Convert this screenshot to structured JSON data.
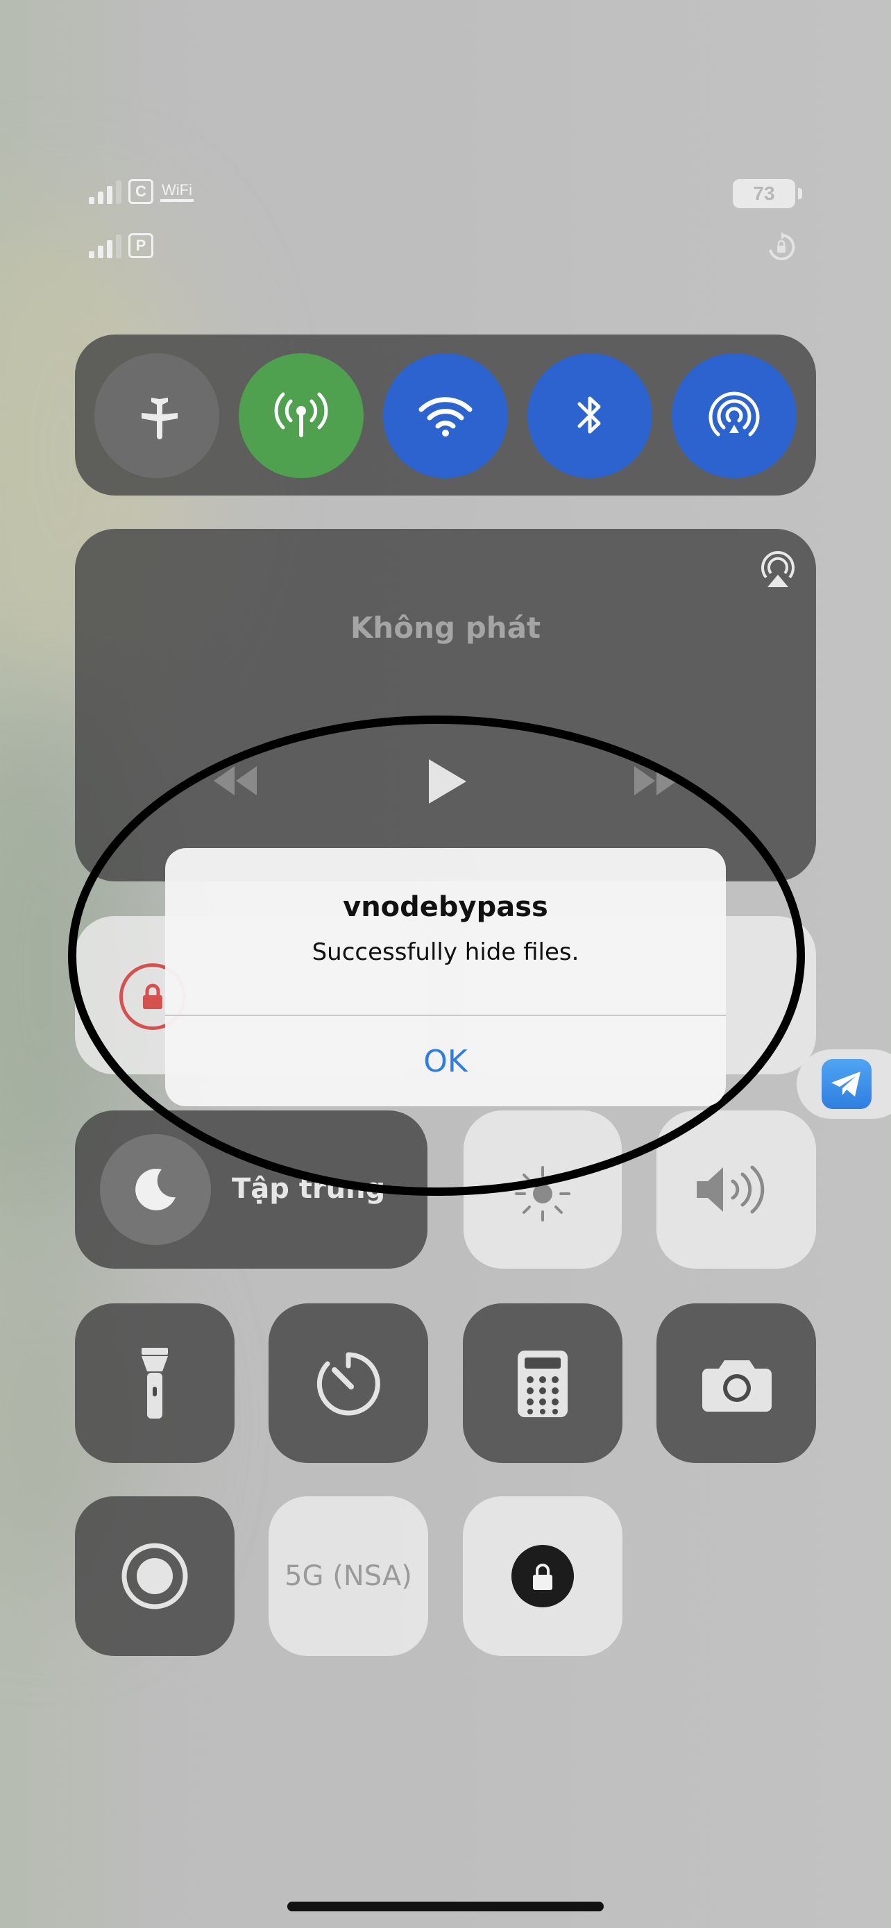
{
  "status": {
    "sim1_label": "C",
    "sim1_network": "WiFi",
    "sim2_label": "P",
    "battery_level": "73"
  },
  "connectivity": {
    "icons": [
      "airplane-icon",
      "cellular-antenna-icon",
      "wifi-icon",
      "bluetooth-icon",
      "airdrop-icon"
    ],
    "colors": {
      "cellular": "#4fa04f",
      "wifi": "#2d63cf",
      "bluetooth": "#2d63cf",
      "airdrop": "#2d63cf"
    }
  },
  "now_playing": {
    "title": "Không phát",
    "icons": [
      "airplay-icon",
      "rewind-icon",
      "play-icon",
      "forward-icon"
    ]
  },
  "focus": {
    "label": "Tập trung"
  },
  "network_mode": {
    "label": "5G (NSA)"
  },
  "alert": {
    "title": "vnodebypass",
    "message": "Successfully hide files.",
    "ok_label": "OK"
  }
}
